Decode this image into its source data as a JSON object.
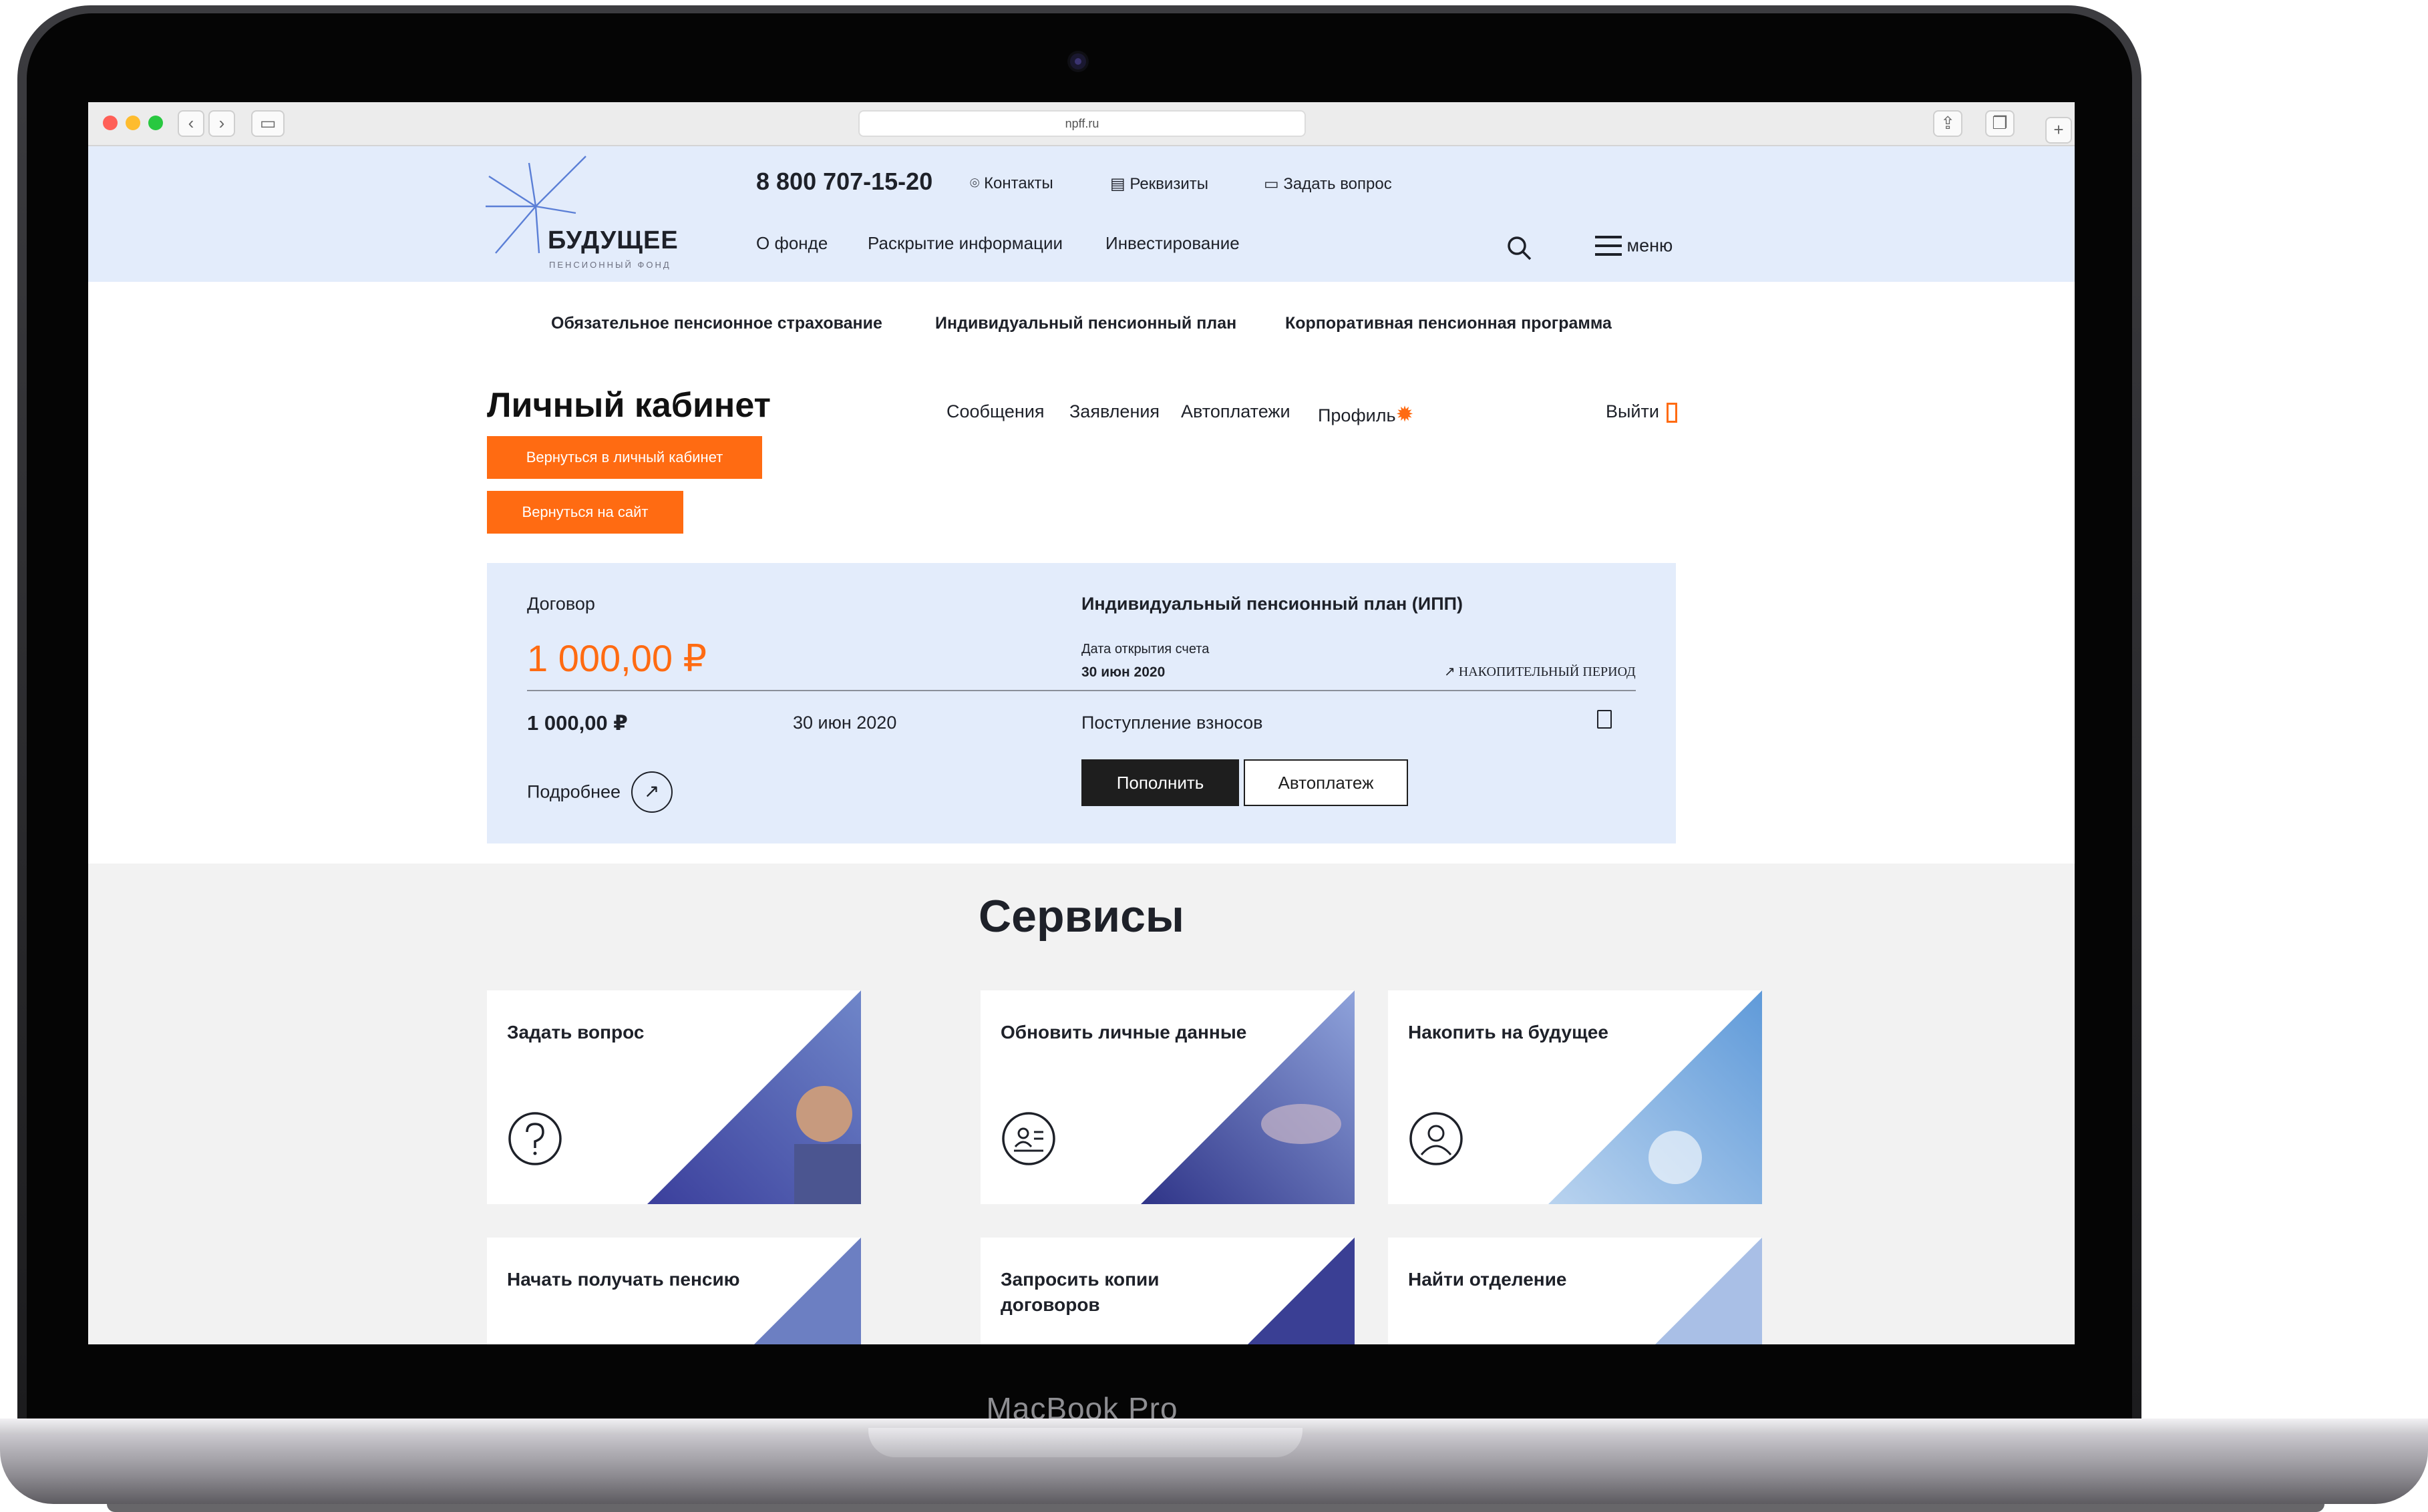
{
  "laptop": {
    "brand": "MacBook Pro"
  },
  "browser": {
    "url": "npff.ru"
  },
  "header": {
    "logo_title": "БУДУЩЕЕ",
    "logo_subtitle": "ПЕНСИОННЫЙ ФОНД",
    "phone": "8 800 707-15-20",
    "links": {
      "contacts": "Контакты",
      "requisites": "Реквизиты",
      "ask": "Задать вопрос"
    },
    "nav": {
      "about": "О фонде",
      "disclosure": "Раскрытие информации",
      "investing": "Инвестирование"
    },
    "menu_label": "меню"
  },
  "subnav": [
    "Обязательное пенсионное страхование",
    "Индивидуальный пенсионный план",
    "Корпоративная пенсионная программа"
  ],
  "cabinet": {
    "title": "Личный кабинет",
    "nav": {
      "messages": "Сообщения",
      "applications": "Заявления",
      "autopay": "Автоплатежи",
      "profile": "Профиль",
      "logout": "Выйти"
    },
    "back_cabinet": "Вернуться в личный кабинет",
    "back_site": "Вернуться на сайт"
  },
  "contract": {
    "label": "Договор",
    "amount": "1 000,00 ₽",
    "row_amount": "1 000,00 ₽",
    "row_date": "30 июн 2020",
    "more": "Подробнее",
    "plan_name": "Индивидуальный пенсионный план (ИПП)",
    "open_date_label": "Дата открытия счета",
    "open_date": "30 июн 2020",
    "period": "НАКОПИТЕЛЬНЫЙ ПЕРИОД",
    "contributions": "Поступление взносов",
    "btn_topup": "Пополнить",
    "btn_autopay": "Автоплатеж"
  },
  "services": {
    "title": "Сервисы",
    "tiles": [
      {
        "title": "Задать вопрос",
        "icon": "question-icon"
      },
      {
        "title": "Обновить личные данные",
        "icon": "id-card-icon"
      },
      {
        "title": "Накопить на будущее",
        "icon": "user-icon"
      },
      {
        "title": "Начать получать пенсию"
      },
      {
        "title": "Запросить копии договоров"
      },
      {
        "title": "Найти отделение"
      }
    ]
  },
  "colors": {
    "accent": "#ff6b12",
    "header_bg": "#e3ecfb",
    "services_bg": "#f2f2f2",
    "logo_blue": "#5b7fd6"
  }
}
